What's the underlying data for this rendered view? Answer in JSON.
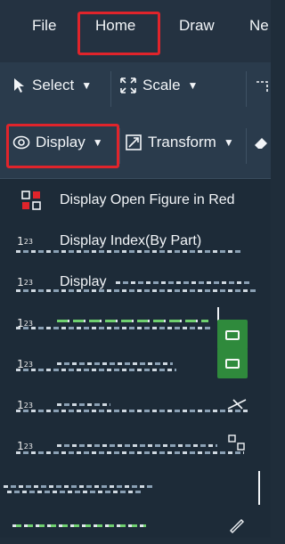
{
  "menubar": {
    "file": "File",
    "home": "Home",
    "draw": "Draw",
    "partial": "Ne"
  },
  "ribbon": {
    "select": "Select",
    "scale": "Scale",
    "display": "Display",
    "transform": "Transform"
  },
  "display_menu": {
    "items": [
      {
        "label": "Display Open Figure in Red"
      },
      {
        "label": "Display Index(By Part)"
      },
      {
        "label": "Display"
      }
    ],
    "badge_text": "1",
    "badge_sub": "2",
    "badge_sub2": "3"
  },
  "colors": {
    "highlight": "#e0242b",
    "accent_green": "#2f8a3c",
    "menu_bg": "#1d2b38"
  }
}
